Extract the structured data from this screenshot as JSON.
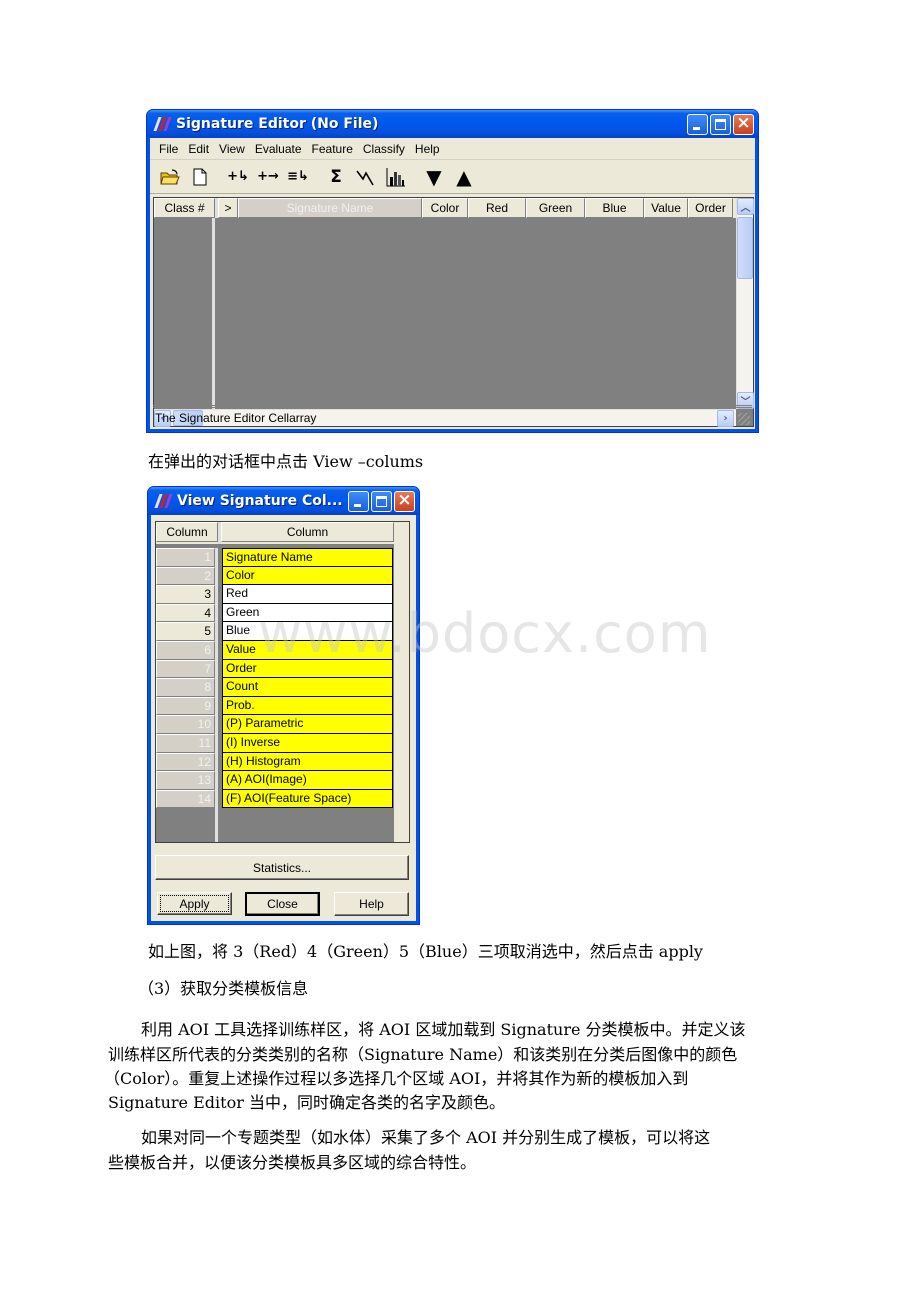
{
  "signature_editor": {
    "title": "Signature Editor (No File)",
    "menu": [
      "File",
      "Edit",
      "View",
      "Evaluate",
      "Feature",
      "Classify",
      "Help"
    ],
    "toolbar": [
      {
        "icon": "open-folder-icon",
        "glyph": "📂"
      },
      {
        "icon": "new-file-icon",
        "glyph": "🗋"
      },
      {
        "icon": "add-signature-icon",
        "glyph": "+↳"
      },
      {
        "icon": "replace-signature-icon",
        "glyph": "+→"
      },
      {
        "icon": "merge-signatures-icon",
        "glyph": "≡↳"
      },
      {
        "icon": "statistics-sigma-icon",
        "glyph": "Σ"
      },
      {
        "icon": "mean-plot-icon",
        "glyph": "⋁⋁"
      },
      {
        "icon": "histogram-icon",
        "glyph": "▙"
      },
      {
        "icon": "move-down-icon",
        "glyph": "▼"
      },
      {
        "icon": "move-up-icon",
        "glyph": "▲"
      }
    ],
    "columns": [
      "Class #",
      ">",
      "Signature Name",
      "Color",
      "Red",
      "Green",
      "Blue",
      "Value",
      "Order"
    ],
    "status": "The Signature Editor Cellarray"
  },
  "instruction_1": "在弹出的对话框中点击 View –colums",
  "view_columns": {
    "title": "View Signature Col...",
    "header": [
      "Column",
      "Column"
    ],
    "rows": [
      {
        "num": "1",
        "label": "Signature Name",
        "selected": true
      },
      {
        "num": "2",
        "label": "Color",
        "selected": true
      },
      {
        "num": "3",
        "label": "Red",
        "selected": false
      },
      {
        "num": "4",
        "label": "Green",
        "selected": false
      },
      {
        "num": "5",
        "label": "Blue",
        "selected": false
      },
      {
        "num": "6",
        "label": "Value",
        "selected": true
      },
      {
        "num": "7",
        "label": "Order",
        "selected": true
      },
      {
        "num": "8",
        "label": "Count",
        "selected": true
      },
      {
        "num": "9",
        "label": "Prob.",
        "selected": true
      },
      {
        "num": "10",
        "label": "(P) Parametric",
        "selected": true
      },
      {
        "num": "11",
        "label": "(I) Inverse",
        "selected": true
      },
      {
        "num": "12",
        "label": "(H) Histogram",
        "selected": true
      },
      {
        "num": "13",
        "label": "(A) AOI(Image)",
        "selected": true
      },
      {
        "num": "14",
        "label": "(F) AOI(Feature Space)",
        "selected": true
      }
    ],
    "statistics_label": "Statistics...",
    "apply_label": "Apply",
    "close_label": "Close",
    "help_label": "Help"
  },
  "watermark": "www.bdocx.com",
  "instruction_2": "如上图，将 3（Red）4（Green）5（Blue）三项取消选中，然后点击 apply",
  "section_heading": "（3）获取分类模板信息",
  "paragraph_1": [
    "利用 AOI 工具选择训练样区，将 AOI 区域加载到 Signature 分类模板中。并定义该",
    "训练样区所代表的分类类别的名称（Signature Name）和该类别在分类后图像中的颜色",
    "（Color）。重复上述操作过程以多选择几个区域 AOI，并将其作为新的模板加入到",
    "Signature Editor 当中，同时确定各类的名字及颜色。"
  ],
  "paragraph_2": [
    "如果对同一个专题类型（如水体）采集了多个 AOI 并分别生成了模板，可以将这",
    "些模板合并，以便该分类模板具多区域的综合特性。"
  ],
  "colors": {
    "selected_cell": "#ffff00",
    "unselected_cell": "#ffffff",
    "cellarray_bg": "#808080",
    "xp_title_blue": "#0058ee",
    "xp_close_red": "#d4502c"
  }
}
